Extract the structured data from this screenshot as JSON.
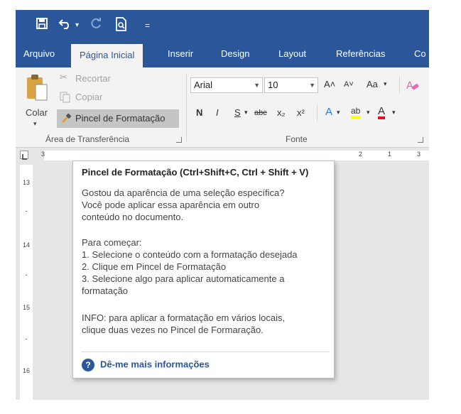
{
  "quick_access": {
    "save_icon": "floppy-disk-icon",
    "undo_icon": "undo-icon",
    "redo_icon": "redo-icon",
    "preview_icon": "print-preview-icon",
    "customize_icon": "customize-qat-icon"
  },
  "tabs": [
    "Arquivo",
    "Página Inicial",
    "Inserir",
    "Design",
    "Layout",
    "Referências",
    "Co"
  ],
  "active_tab": "Página Inicial",
  "clipboard": {
    "paste_label": "Colar",
    "cut_label": "Recortar",
    "copy_label": "Copiar",
    "format_painter_label": "Pincel de Formatação",
    "group_label": "Área de Transferência"
  },
  "font": {
    "family": "Arial",
    "size": "10",
    "grow_label": "A˄",
    "shrink_label": "A˅",
    "case_label": "Aa",
    "bold_label": "N",
    "italic_label": "I",
    "underline_label": "S",
    "strike_label": "abc",
    "subscript_label": "x₂",
    "superscript_label": "x²",
    "effects_label": "A",
    "highlight_label": "ab",
    "color_label": "A",
    "group_label": "Fonte"
  },
  "ruler": {
    "top_marks": [
      "3",
      "2",
      "1",
      "3"
    ],
    "side_marks": [
      "13",
      "14",
      "15",
      "16"
    ]
  },
  "tooltip": {
    "title": "Pincel de Formatação (Ctrl+Shift+C, Ctrl + Shift + V)",
    "intro": [
      "Gostou da aparência de uma seleção específica?",
      "Você pode aplicar essa aparência em outro",
      "conteúdo no documento."
    ],
    "steps_title": "Para começar:",
    "steps": [
      "1. Selecione o conteúdo com a formatação desejada",
      "2. Clique em Pincel de Formatação",
      "3. Selecione algo para aplicar automaticamente a",
      "formatação"
    ],
    "info": [
      "INFO: para aplicar a formatação em vários locais,",
      "clique duas vezes no Pincel de Formaração."
    ],
    "link": "Dê-me mais informações"
  },
  "colors": {
    "brand": "#2b579a",
    "ribbon": "#f3f3f3",
    "highlight": "#ffff00",
    "font_color": "#e81123"
  }
}
